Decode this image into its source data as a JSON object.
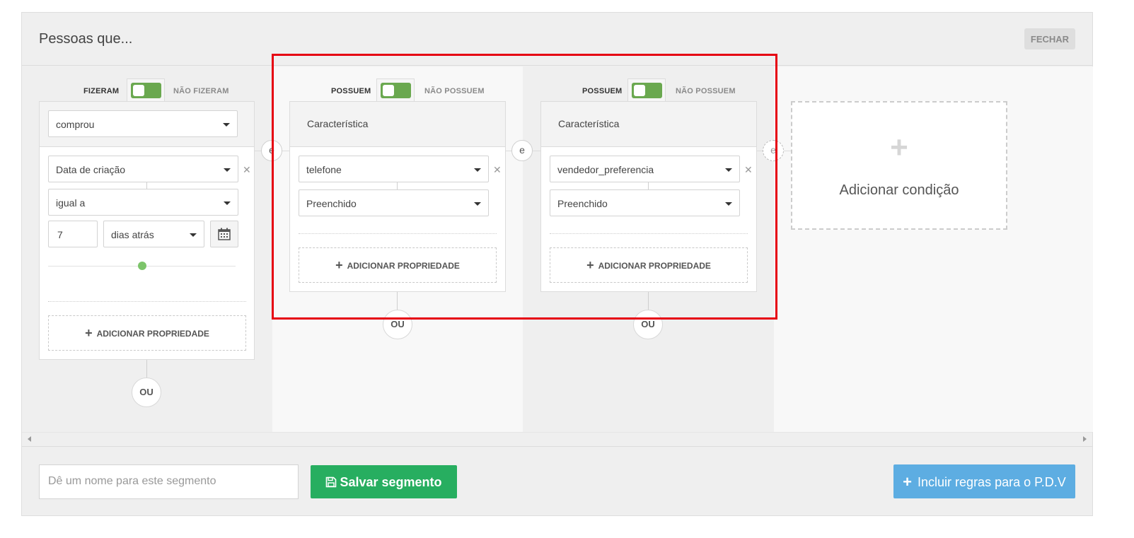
{
  "header": {
    "title": "Pessoas que...",
    "close_label": "FECHAR"
  },
  "condition1": {
    "toggle_active": "FIZERAM",
    "toggle_inactive": "NÃO FIZERAM",
    "event_select": "comprou",
    "property_select": "Data de criação",
    "operator_select": "igual a",
    "days_value": "7",
    "days_unit_select": "dias atrás",
    "add_property_label": "ADICIONAR PROPRIEDADE",
    "ou_label": "OU"
  },
  "condition2": {
    "toggle_active": "POSSUEM",
    "toggle_inactive": "NÃO POSSUEM",
    "header_field": "Característica",
    "property_select": "telefone",
    "operator_select": "Preenchido",
    "add_property_label": "ADICIONAR PROPRIEDADE",
    "ou_label": "OU"
  },
  "condition3": {
    "toggle_active": "POSSUEM",
    "toggle_inactive": "NÃO POSSUEM",
    "header_field": "Característica",
    "property_select": "vendedor_preferencia",
    "operator_select": "Preenchido",
    "add_property_label": "ADICIONAR PROPRIEDADE",
    "ou_label": "OU"
  },
  "connectors": {
    "and_label": "e"
  },
  "add_condition": {
    "label": "Adicionar condição"
  },
  "footer": {
    "name_placeholder": "Dê um nome para este segmento",
    "save_label": "Salvar segmento",
    "pdv_label": "Incluir regras para o P.D.V"
  },
  "colors": {
    "toggle_green": "#6aa84f",
    "save_green": "#27ae60",
    "pdv_blue": "#5dade2",
    "highlight_red": "#e60012"
  }
}
